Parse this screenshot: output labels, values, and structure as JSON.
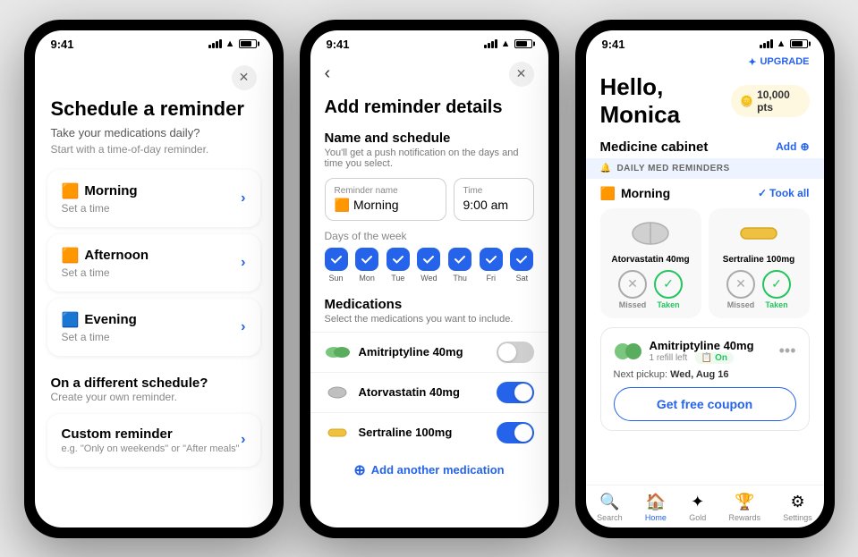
{
  "phone1": {
    "statusBar": {
      "time": "9:41"
    },
    "title": "Schedule a reminder",
    "subtitle": "Take your medications daily?",
    "desc": "Start with a time-of-day reminder.",
    "options": [
      {
        "emoji": "🟧",
        "label": "Morning",
        "sub": "Set a time"
      },
      {
        "emoji": "🟧",
        "label": "Afternoon",
        "sub": "Set a time"
      },
      {
        "emoji": "🟦",
        "label": "Evening",
        "sub": "Set a time"
      }
    ],
    "sectionTitle": "On a different schedule?",
    "sectionDesc": "Create your own reminder.",
    "customLabel": "Custom reminder",
    "customSub": "e.g. \"Only on weekends\" or \"After meals\""
  },
  "phone2": {
    "statusBar": {
      "time": "9:41"
    },
    "title": "Add reminder details",
    "sectionTitle": "Name and schedule",
    "sectionDesc": "You'll get a push notification on the days and time you select.",
    "reminderNameLabel": "Reminder name",
    "reminderNameValue": "Morning",
    "reminderNameEmoji": "🟧",
    "timeLabel": "Time",
    "timeValue": "9:00 am",
    "daysLabel": "Days of the week",
    "days": [
      "Sun",
      "Mon",
      "Tue",
      "Wed",
      "Thu",
      "Fri",
      "Sat"
    ],
    "daysChecked": [
      true,
      true,
      true,
      true,
      true,
      true,
      true
    ],
    "medsTitle": "Medications",
    "medsDesc": "Select the medications you want to include.",
    "medications": [
      {
        "name": "Amitriptyline 40mg",
        "on": false,
        "colorA": "#7bc67e",
        "colorB": "#5aad5e"
      },
      {
        "name": "Atorvastatin 40mg",
        "on": true,
        "colorA": "#c0c0c0",
        "colorB": "#a0a0a0"
      },
      {
        "name": "Sertraline 100mg",
        "on": true,
        "colorA": "#f0c040",
        "colorB": "#d4a820"
      }
    ],
    "addMedLabel": "Add another medication"
  },
  "phone3": {
    "statusBar": {
      "time": "9:41"
    },
    "upgradeLabel": "UPGRADE",
    "greetingLabel": "Hello, Monica",
    "points": "10,000 pts",
    "cabinetTitle": "Medicine cabinet",
    "addLabel": "Add",
    "dailyRemHeader": "DAILY MED REMINDERS",
    "morningLabel": "Morning",
    "morningEmoji": "🟧",
    "tookAllLabel": "Took all",
    "meds": [
      {
        "name": "Atorvastatin 40mg",
        "type": "white",
        "missed": true,
        "taken": false
      },
      {
        "name": "Sertraline 100mg",
        "type": "yellow",
        "missed": true,
        "taken": true
      }
    ],
    "amiName": "Amitriptyline 40mg",
    "amiRefill": "1 refill left",
    "amiOn": "On",
    "pickupLabel": "Next pickup:",
    "pickupDate": "Wed, Aug 16",
    "couponLabel": "Get free coupon",
    "nav": [
      {
        "icon": "🔍",
        "label": "Search",
        "active": false
      },
      {
        "icon": "🏠",
        "label": "Home",
        "active": true
      },
      {
        "icon": "✦",
        "label": "Gold",
        "active": false
      },
      {
        "icon": "🏆",
        "label": "Rewards",
        "active": false
      },
      {
        "icon": "⚙",
        "label": "Settings",
        "active": false
      }
    ]
  }
}
